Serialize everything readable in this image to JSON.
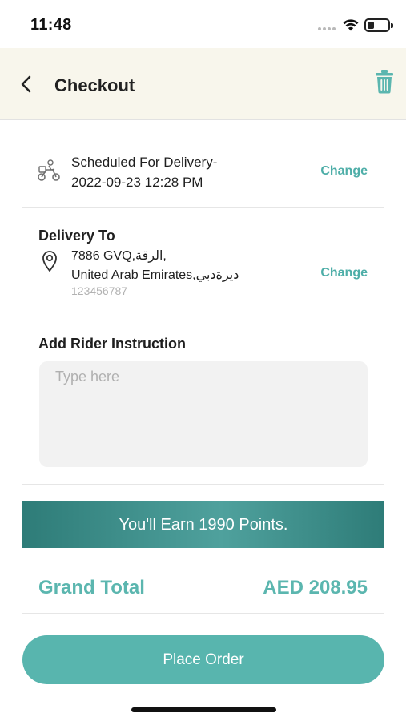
{
  "status_bar": {
    "time": "11:48",
    "signal_icon": "signal-dots-icon",
    "wifi_icon": "wifi-icon",
    "battery_icon": "battery-icon",
    "battery_level": 0.25
  },
  "header": {
    "back_icon": "chevron-left-icon",
    "title": "Checkout",
    "trash_icon": "trash-icon",
    "background_color": "#f8f6ec",
    "icon_color": "#5bb6af"
  },
  "schedule": {
    "icon": "delivery-scooter-icon",
    "line1": "Scheduled For Delivery-",
    "line2": "2022-09-23 12:28 PM",
    "change_label": "Change"
  },
  "delivery": {
    "title": "Delivery To",
    "icon": "location-pin-icon",
    "address_line1": "7886 GVQ,الرقة,",
    "address_line2": "United Arab Emirates,ديرةدبي",
    "phone": "123456787",
    "change_label": "Change"
  },
  "rider": {
    "title": "Add Rider Instruction",
    "placeholder": "Type here",
    "value": ""
  },
  "points_banner": {
    "text": "You'll Earn 1990 Points."
  },
  "total": {
    "label": "Grand Total",
    "value": "AED 208.95"
  },
  "actions": {
    "place_order_label": "Place Order"
  },
  "colors": {
    "accent": "#58b5ae",
    "accent_dark": "#2e7c78",
    "link": "#4eaea8"
  }
}
